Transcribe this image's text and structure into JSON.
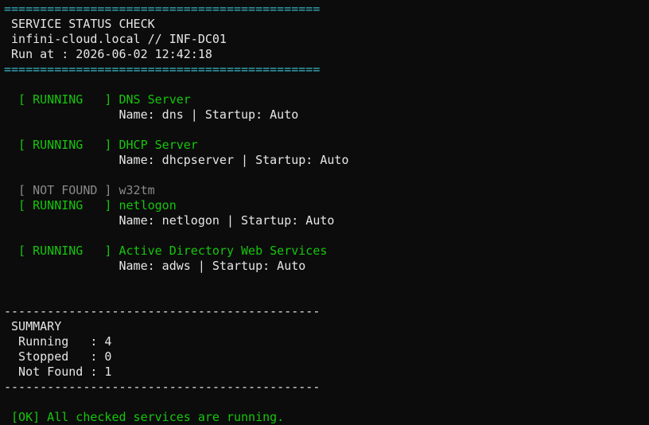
{
  "header": {
    "border": "============================================",
    "title": " SERVICE STATUS CHECK",
    "host": " infini-cloud.local // INF-DC01",
    "run_at": " Run at : 2026-06-02 12:42:18"
  },
  "services": [
    {
      "status": "  [ RUNNING   ] ",
      "display_name": "DNS Server",
      "detail": "                Name: dns | Startup: Auto"
    },
    {
      "status": "  [ RUNNING   ] ",
      "display_name": "DHCP Server",
      "detail": "                Name: dhcpserver | Startup: Auto"
    },
    {
      "status": "  [ NOT FOUND ] ",
      "display_name": "w32tm"
    },
    {
      "status": "  [ RUNNING   ] ",
      "display_name": "netlogon",
      "detail": "                Name: netlogon | Startup: Auto"
    },
    {
      "status": "  [ RUNNING   ] ",
      "display_name": "Active Directory Web Services",
      "detail": "                Name: adws | Startup: Auto"
    }
  ],
  "summary": {
    "divider": "--------------------------------------------",
    "title": " SUMMARY",
    "running": "  Running   : 4",
    "stopped": "  Stopped   : 0",
    "not_found": "  Not Found : 1"
  },
  "result": " [OK] All checked services are running.",
  "colors": {
    "background": "#0c0c0c",
    "border": "#3ab7c8",
    "running": "#16c60c",
    "not_found": "#8a8a8a",
    "text": "#d6d6d6"
  }
}
